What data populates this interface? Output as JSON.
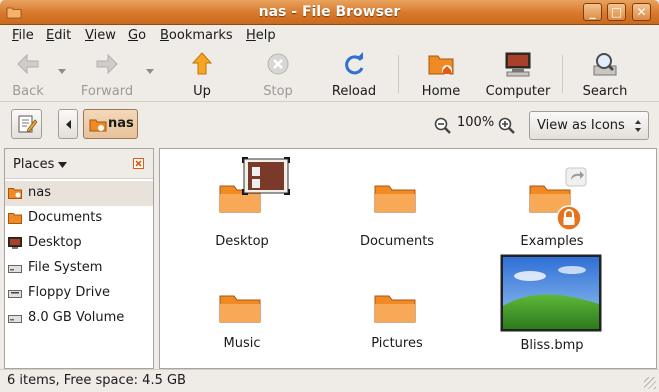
{
  "window": {
    "title": "nas - File Browser",
    "buttons": {
      "minimize": "_",
      "maximize": "□",
      "close": "✕"
    }
  },
  "menubar": {
    "items": [
      {
        "label": "File",
        "mnemonic": "F",
        "rest": "ile"
      },
      {
        "label": "Edit",
        "mnemonic": "E",
        "rest": "dit"
      },
      {
        "label": "View",
        "mnemonic": "V",
        "rest": "iew"
      },
      {
        "label": "Go",
        "mnemonic": "G",
        "rest": "o"
      },
      {
        "label": "Bookmarks",
        "mnemonic": "B",
        "rest": "ookmarks"
      },
      {
        "label": "Help",
        "mnemonic": "H",
        "rest": "elp"
      }
    ]
  },
  "toolbar": {
    "back": "Back",
    "forward": "Forward",
    "up": "Up",
    "stop": "Stop",
    "reload": "Reload",
    "home": "Home",
    "computer": "Computer",
    "search": "Search"
  },
  "location": {
    "path_button": "nas",
    "zoom": "100%",
    "view_mode": "View as Icons"
  },
  "sidebar": {
    "header": "Places",
    "items": [
      {
        "label": "nas",
        "icon": "home-folder-icon",
        "selected": true
      },
      {
        "label": "Documents",
        "icon": "folder-icon"
      },
      {
        "label": "Desktop",
        "icon": "desktop-icon"
      },
      {
        "label": "File System",
        "icon": "drive-icon"
      },
      {
        "label": "Floppy Drive",
        "icon": "floppy-icon"
      },
      {
        "label": "8.0 GB Volume",
        "icon": "drive-icon"
      }
    ]
  },
  "files": [
    {
      "name": "Desktop",
      "icon": "folder-desktop-icon"
    },
    {
      "name": "Documents",
      "icon": "folder-icon"
    },
    {
      "name": "Examples",
      "icon": "folder-symlink-locked-icon"
    },
    {
      "name": "Music",
      "icon": "folder-icon"
    },
    {
      "name": "Pictures",
      "icon": "folder-icon"
    },
    {
      "name": "Bliss.bmp",
      "icon": "image-thumbnail-icon"
    }
  ],
  "status": {
    "text": "6 items, Free space: 4.5 GB"
  },
  "colors": {
    "folder_orange": "#f08a24",
    "title_orange": "#d8782b",
    "sky_blue": "#2f6fd6",
    "grass_green": "#3e9a2a"
  }
}
